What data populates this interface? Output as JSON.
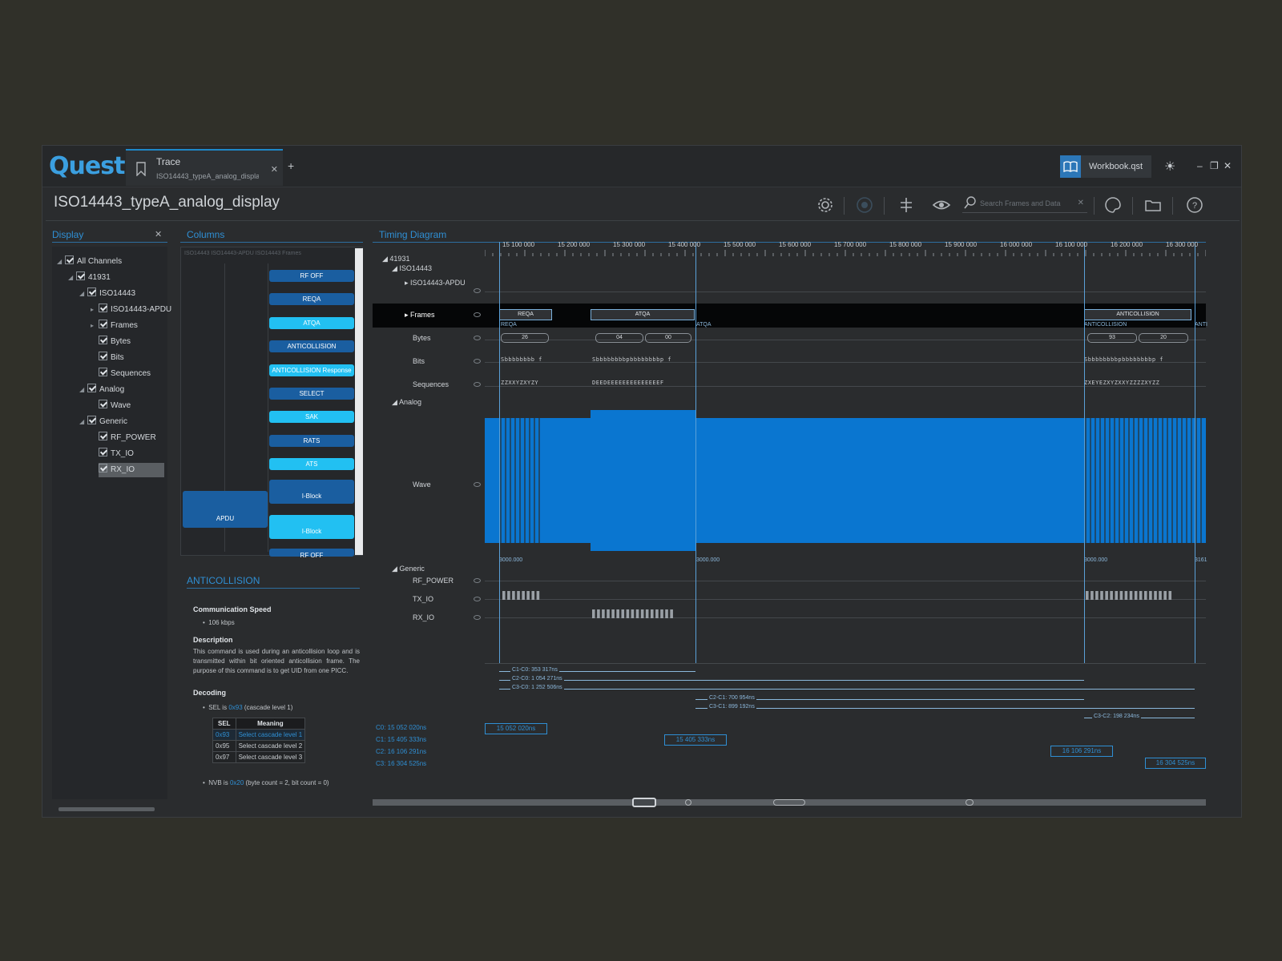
{
  "app": {
    "logo": "Quest"
  },
  "tab": {
    "title": "Trace",
    "subtitle": "ISO14443_typeA_analog_display"
  },
  "workbook": {
    "label": "Workbook.qst"
  },
  "document": {
    "title": "ISO14443_typeA_analog_display"
  },
  "search": {
    "placeholder": "Search Frames and Data"
  },
  "panels": {
    "display": "Display",
    "columns": "Columns",
    "timing": "Timing Diagram"
  },
  "tree": [
    {
      "label": "All Channels"
    },
    {
      "label": "41931"
    },
    {
      "label": "ISO14443"
    },
    {
      "label": "ISO14443-APDU"
    },
    {
      "label": "Frames"
    },
    {
      "label": "Bytes"
    },
    {
      "label": "Bits"
    },
    {
      "label": "Sequences"
    },
    {
      "label": "Analog"
    },
    {
      "label": "Wave"
    },
    {
      "label": "Generic"
    },
    {
      "label": "RF_POWER"
    },
    {
      "label": "TX_IO"
    },
    {
      "label": "RX_IO"
    }
  ],
  "columns": {
    "header": "ISO14443 ISO14443-APDU ISO14443 Frames",
    "commands": [
      "RF OFF",
      "REQA",
      "ATQA",
      "ANTICOLLISION",
      "ANTICOLLISION Response",
      "SELECT",
      "SAK",
      "RATS",
      "ATS",
      "I-Block",
      "I-Block",
      "RF OFF"
    ],
    "apdu": "APDU"
  },
  "info": {
    "title": "ANTICOLLISION",
    "speed_h": "Communication Speed",
    "speed": "106 kbps",
    "desc_h": "Description",
    "desc": "This command is used during an anticollision loop and is transmitted within bit oriented anticollision frame. The purpose of this command is to get UID from one PICC.",
    "decoding_h": "Decoding",
    "sel_text_pre": "SEL is",
    "sel_val": "0x93",
    "sel_text_post": "(cascade level 1)",
    "table_head": [
      "SEL",
      "Meaning"
    ],
    "table_rows": [
      [
        "0x93",
        "Select cascade level 1"
      ],
      [
        "0x95",
        "Select cascade level 2"
      ],
      [
        "0x97",
        "Select cascade level 3"
      ]
    ],
    "nvb_pre": "NVB is",
    "nvb_val": "0x20",
    "nvb_post": "(byte count = 2, bit count = 0)"
  },
  "timing": {
    "ticks": [
      "15 100 000",
      "15 200 000",
      "15 300 000",
      "15 400 000",
      "15 500 000",
      "15 600 000",
      "15 700 000",
      "15 800 000",
      "15 900 000",
      "16 000 000",
      "16 100 000",
      "16 200 000",
      "16 300 000"
    ],
    "rows": {
      "root": "41931",
      "iso": "ISO14443",
      "apdu": "ISO14443-APDU",
      "frames": "Frames",
      "bytes": "Bytes",
      "bits": "Bits",
      "seq": "Sequences",
      "analog": "Analog",
      "wave": "Wave",
      "generic": "Generic",
      "rf": "RF_POWER",
      "tx": "TX_IO",
      "rx": "RX_IO"
    },
    "frames": [
      "REQA",
      "ATQA",
      "ANTICOLLISION"
    ],
    "frame_tags": [
      "REQA",
      "ATQA",
      "ANTICOLLISION",
      "ANTI"
    ],
    "bytes": [
      "26",
      "04",
      "00",
      "93",
      "20"
    ],
    "bits": [
      "Sbbbbbbbb f",
      "Sbbbbbbbbpbbbbbbbbp f",
      "Sbbbbbbbbpbbbbbbbbp f"
    ],
    "sequences": [
      "ZZXXYZXYZY",
      "DEEDEEEEEEEEEEEEEEF",
      "ZXEYEZXYZXXYZZZZXYZZ"
    ],
    "wave_marks": [
      "3000.000",
      "3000.000",
      "3000.000",
      "3161"
    ],
    "measurements": [
      "C1-C0: 353 317ns",
      "C2-C0: 1 054 271ns",
      "C3-C0: 1 252 506ns",
      "C2-C1: 700 954ns",
      "C3-C1: 899 192ns",
      "C3-C2: 198 234ns"
    ],
    "cursors": [
      {
        "label": "C0: 15 052 020ns",
        "box": "15 052 020ns"
      },
      {
        "label": "C1: 15 405 333ns",
        "box": "15 405 333ns"
      },
      {
        "label": "C2: 16 106 291ns",
        "box": "16 106 291ns"
      },
      {
        "label": "C3: 16 304 525ns",
        "box": "16 304 525ns"
      }
    ]
  }
}
